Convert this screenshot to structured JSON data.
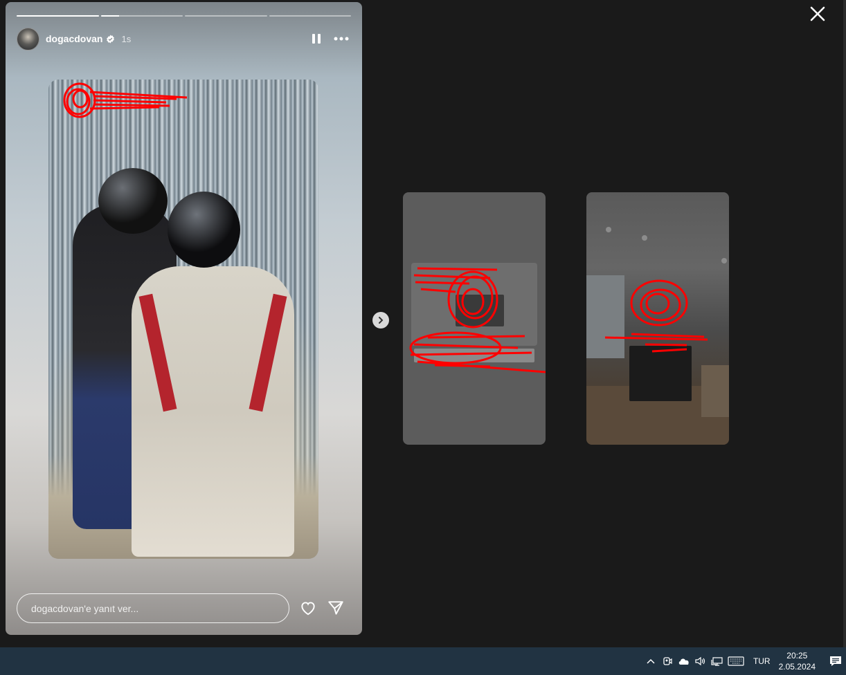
{
  "story": {
    "username": "dogacdovan",
    "time_ago": "1s",
    "verified": true,
    "progress_segments": [
      1,
      0.22,
      0,
      0
    ],
    "reply_placeholder": "dogacdovan'e yanıt ver..."
  },
  "icons": {
    "pause": "pause-icon",
    "more": "more-icon",
    "like": "heart-icon",
    "share": "send-icon",
    "next": "chevron-right-icon",
    "close": "close-icon"
  },
  "colors": {
    "background": "#1a1a1a",
    "redaction": "#ff0000",
    "taskbar": "#213342"
  },
  "taskbar": {
    "language": "TUR",
    "time": "20:25",
    "date": "2.05.2024"
  }
}
